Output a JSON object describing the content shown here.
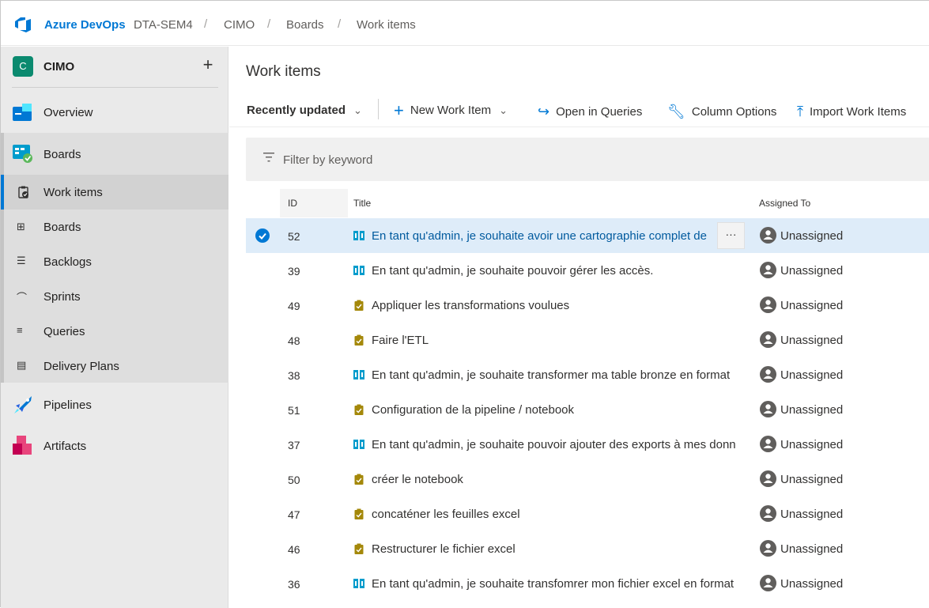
{
  "header": {
    "brand": "Azure DevOps",
    "breadcrumbs": [
      "DTA-SEM4",
      "CIMO",
      "Boards",
      "Work items"
    ],
    "separator": "/"
  },
  "sidebar": {
    "project": {
      "initial": "C",
      "name": "CIMO",
      "add": "+"
    },
    "items": [
      {
        "label": "Overview",
        "icon": "overview-icon"
      },
      {
        "label": "Boards",
        "icon": "boards-icon"
      },
      {
        "label": "Work items",
        "icon": "work-items-icon"
      },
      {
        "label": "Boards",
        "icon": "kanban-icon"
      },
      {
        "label": "Backlogs",
        "icon": "backlog-icon"
      },
      {
        "label": "Sprints",
        "icon": "sprints-icon"
      },
      {
        "label": "Queries",
        "icon": "queries-icon"
      },
      {
        "label": "Delivery Plans",
        "icon": "delivery-plans-icon"
      },
      {
        "label": "Pipelines",
        "icon": "pipelines-icon"
      },
      {
        "label": "Artifacts",
        "icon": "artifacts-icon"
      }
    ]
  },
  "main": {
    "title": "Work items",
    "toolbar": {
      "view": "Recently updated",
      "new_item": "New Work Item",
      "open_queries": "Open in Queries",
      "column_options": "Column Options",
      "import": "Import Work Items"
    },
    "filter": {
      "placeholder": "Filter by keyword"
    },
    "columns": {
      "id": "ID",
      "title": "Title",
      "assigned": "Assigned To"
    },
    "more_label": "···",
    "rows": [
      {
        "id": "52",
        "title": "En tant qu'admin, je souhaite avoir une cartographie complet de",
        "type": "story",
        "assigned": "Unassigned",
        "selected": true
      },
      {
        "id": "39",
        "title": "En tant qu'admin, je souhaite pouvoir gérer les accès.",
        "type": "story",
        "assigned": "Unassigned"
      },
      {
        "id": "49",
        "title": "Appliquer les transformations voulues",
        "type": "task",
        "assigned": "Unassigned"
      },
      {
        "id": "48",
        "title": "Faire l'ETL",
        "type": "task",
        "assigned": "Unassigned"
      },
      {
        "id": "38",
        "title": "En tant qu'admin, je souhaite transformer ma table bronze en format",
        "type": "story",
        "assigned": "Unassigned"
      },
      {
        "id": "51",
        "title": "Configuration de la pipeline / notebook",
        "type": "task",
        "assigned": "Unassigned"
      },
      {
        "id": "37",
        "title": "En tant qu'admin, je souhaite pouvoir ajouter des exports à mes donn",
        "type": "story",
        "assigned": "Unassigned"
      },
      {
        "id": "50",
        "title": "créer le notebook",
        "type": "task",
        "assigned": "Unassigned"
      },
      {
        "id": "47",
        "title": "concaténer les feuilles excel",
        "type": "task",
        "assigned": "Unassigned"
      },
      {
        "id": "46",
        "title": "Restructurer le fichier excel",
        "type": "task",
        "assigned": "Unassigned"
      },
      {
        "id": "36",
        "title": "En tant qu'admin, je souhaite transfomrer mon fichier excel en format",
        "type": "story",
        "assigned": "Unassigned"
      }
    ]
  },
  "colors": {
    "accent": "#0078d4",
    "story": "#009ccc",
    "task": "#a4880a"
  }
}
